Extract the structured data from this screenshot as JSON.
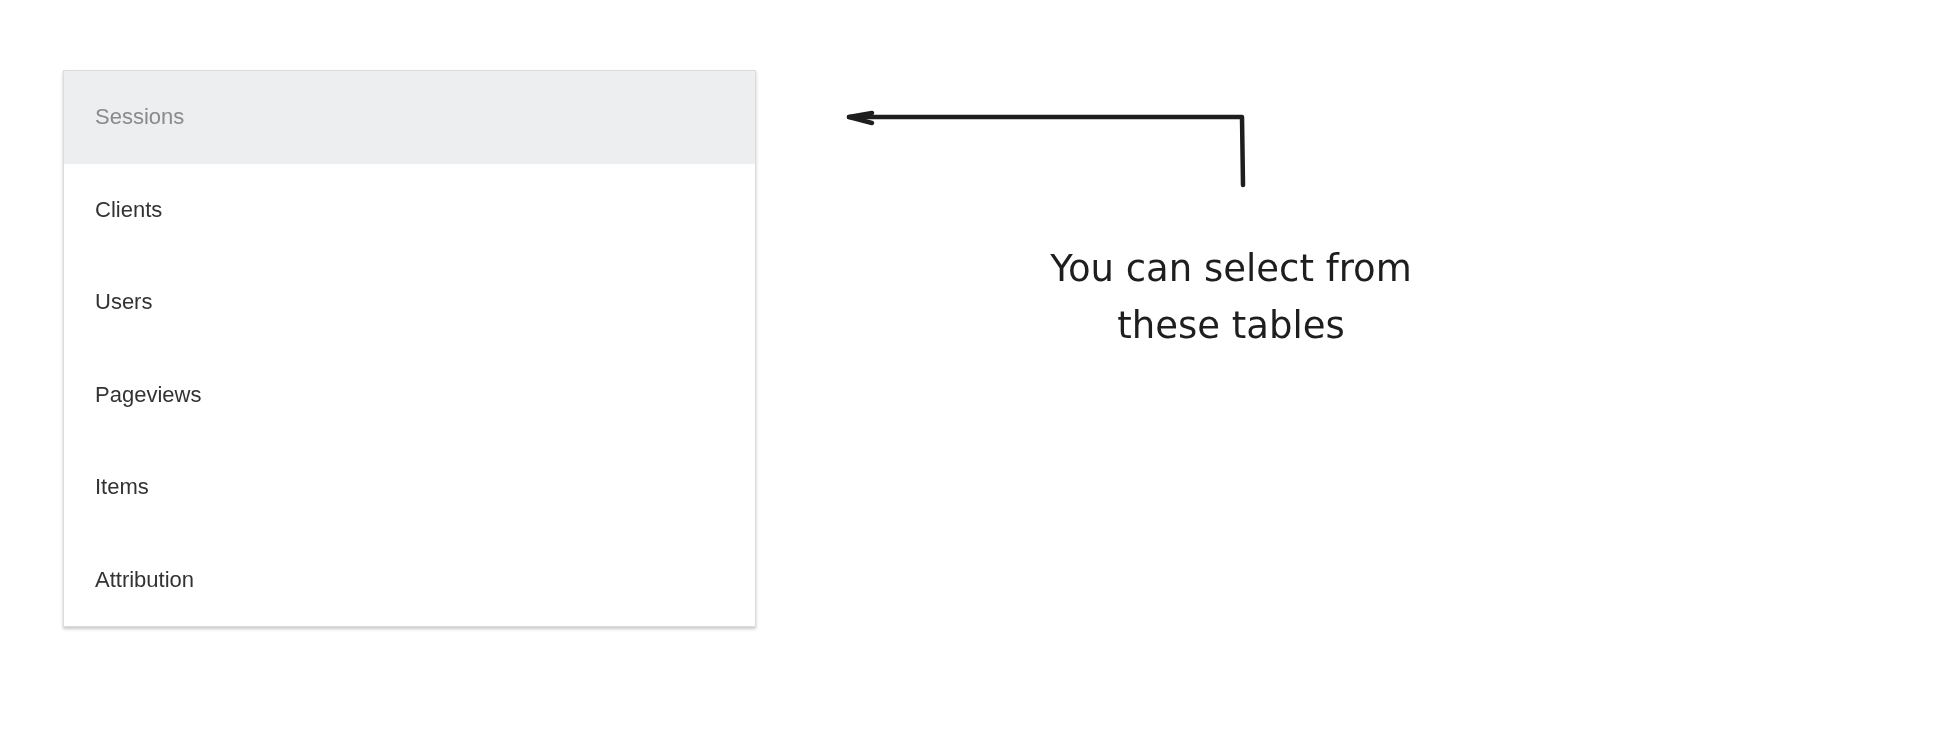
{
  "menu": {
    "items": [
      {
        "label": "Sessions",
        "selected": true
      },
      {
        "label": "Clients",
        "selected": false
      },
      {
        "label": "Users",
        "selected": false
      },
      {
        "label": "Pageviews",
        "selected": false
      },
      {
        "label": "Items",
        "selected": false
      },
      {
        "label": "Attribution",
        "selected": false
      }
    ]
  },
  "annotation": {
    "text": "You can select from these tables"
  }
}
